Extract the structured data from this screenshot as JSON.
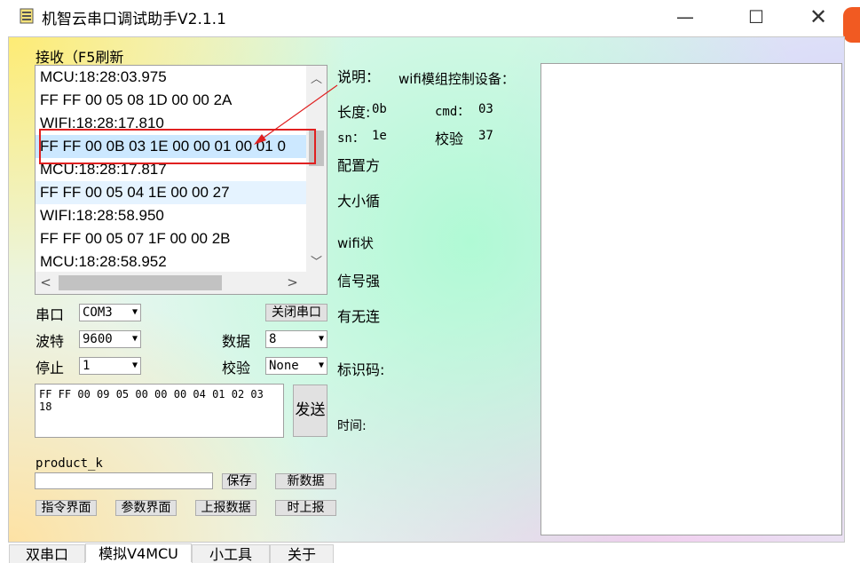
{
  "window": {
    "title": "机智云串口调试助手V2.1.1",
    "min_glyph": "—",
    "max_glyph": "☐",
    "close_glyph": "✕"
  },
  "receive": {
    "label": "接收（F5刷新",
    "rows": [
      "MCU:18:28:03.975",
      "FF FF 00 05 08 1D 00 00 2A",
      "WIFI:18:28:17.810",
      "FF FF 00 0B 03 1E 00 00 01 00 01 0",
      "MCU:18:28:17.817",
      "FF FF 00 05 04 1E 00 00 27",
      "WIFI:18:28:58.950",
      "FF FF 00 05 07 1F 00 00 2B",
      "MCU:18:28:58.952"
    ],
    "scroll_up": "︿",
    "scroll_down": "﹀",
    "scroll_left": "<",
    "scroll_right": ">"
  },
  "settings": {
    "port_label": "串口",
    "port_value": "COM3",
    "baud_label": "波特",
    "baud_value": "9600",
    "stop_label": "停止",
    "stop_value": "1",
    "data_label": "数据",
    "data_value": "8",
    "parity_label": "校验",
    "parity_value": "None",
    "close_port_button": "关闭串口",
    "dropdown_glyph": "▼"
  },
  "send": {
    "text": "FF FF 00 09 05 00 00 00 04 01 02 03 18",
    "button": "发送"
  },
  "product": {
    "label": "product_k",
    "save_button": "保存",
    "new_data_button": "新数据",
    "cmd_ui_button": "指令界面",
    "param_ui_button": "参数界面",
    "report_data_button": "上报数据",
    "timed_report_button": "时上报"
  },
  "info": {
    "desc_label": "说明：",
    "length_label": "长度:",
    "length_value": "0b",
    "cmd_label": "cmd：",
    "cmd_value": "03",
    "sn_label": "sn：",
    "sn_value": "1e",
    "checksum_label": "校验",
    "checksum_value": "37",
    "config_label": "配置方",
    "size_label": "大小循",
    "wifi_status_label": "wifi状",
    "signal_label": "信号强",
    "connect_label": "有无连",
    "id_label": "标识码:",
    "time_label": "时间:",
    "wifi_control_label": "wifi模组控制设备："
  },
  "tabs": [
    {
      "label": "双串口",
      "active": false
    },
    {
      "label": "模拟V4MCU",
      "active": true
    },
    {
      "label": "小工具",
      "active": false
    },
    {
      "label": "关于",
      "active": false
    }
  ],
  "colors": {
    "selection": "#cce8ff",
    "annotation": "#e02020",
    "button_face": "#e1e1e1"
  }
}
